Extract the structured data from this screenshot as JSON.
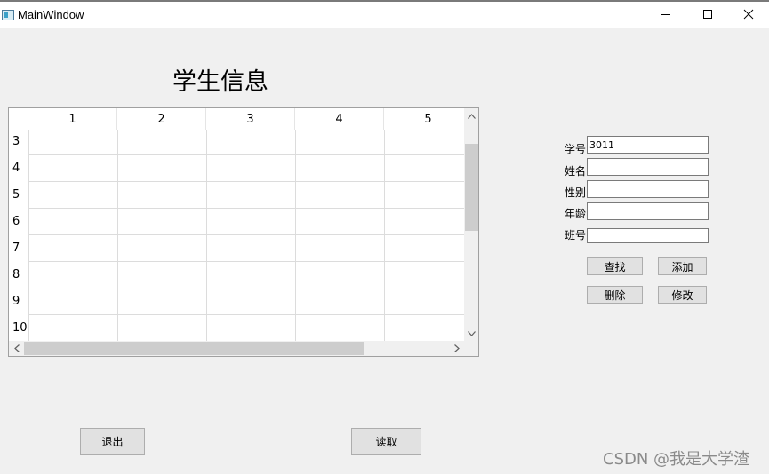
{
  "window": {
    "title": "MainWindow"
  },
  "heading": "学生信息",
  "table": {
    "columns": [
      "1",
      "2",
      "3",
      "4",
      "5"
    ],
    "rows": [
      "3",
      "4",
      "5",
      "6",
      "7",
      "8",
      "9",
      "10"
    ]
  },
  "form": {
    "student_id": {
      "label": "学号",
      "value": "3011"
    },
    "name": {
      "label": "姓名",
      "value": ""
    },
    "gender": {
      "label": "性别",
      "value": ""
    },
    "age": {
      "label": "年龄",
      "value": ""
    },
    "class_no": {
      "label": "班号",
      "value": ""
    }
  },
  "buttons": {
    "search": "查找",
    "add": "添加",
    "delete": "删除",
    "modify": "修改",
    "exit": "退出",
    "read": "读取"
  },
  "watermark": "CSDN @我是大学渣"
}
